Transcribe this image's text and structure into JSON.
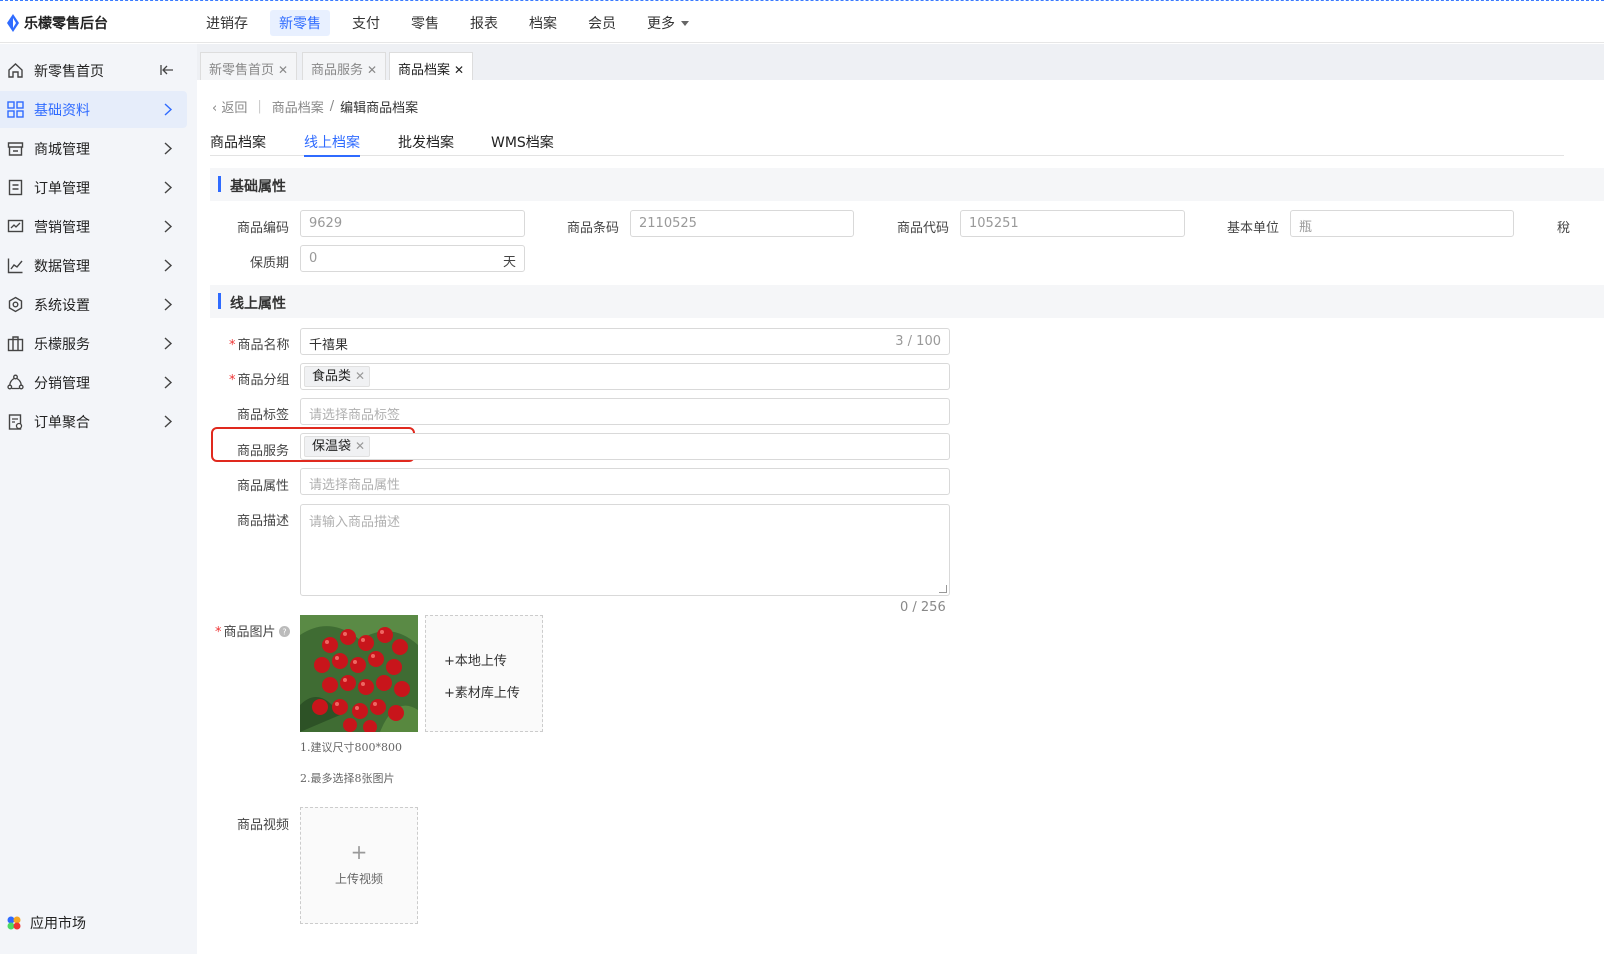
{
  "app": {
    "title": "乐檬零售后台"
  },
  "topnav": [
    "进销存",
    "新零售",
    "支付",
    "零售",
    "报表",
    "档案",
    "会员",
    "更多"
  ],
  "sidebar": {
    "items": [
      "新零售首页",
      "基础资料",
      "商城管理",
      "订单管理",
      "营销管理",
      "数据管理",
      "系统设置",
      "乐檬服务",
      "分销管理",
      "订单聚合"
    ],
    "footer": "应用市场"
  },
  "tabs": [
    {
      "label": "新零售首页"
    },
    {
      "label": "商品服务"
    },
    {
      "label": "商品档案"
    }
  ],
  "breadcrumb": {
    "back": "返回",
    "parent": "商品档案",
    "separator": "/",
    "current": "编辑商品档案"
  },
  "subtabs": [
    "商品档案",
    "线上档案",
    "批发档案",
    "WMS档案"
  ],
  "basic": {
    "title": "基础属性",
    "code_label": "商品编码",
    "code_value": "9629",
    "barcode_label": "商品条码",
    "barcode_value": "2110525",
    "itemcode_label": "商品代码",
    "itemcode_value": "105251",
    "unit_label": "基本单位",
    "unit_value": "瓶",
    "cut_label": "稅",
    "shelf_label": "保质期",
    "shelf_value": "0",
    "shelf_unit": "天"
  },
  "online": {
    "title": "线上属性",
    "name_label": "商品名称",
    "name_value": "千禧果",
    "name_count": "3 / 100",
    "group_label": "商品分组",
    "group_tag": "食品类",
    "tag_label": "商品标签",
    "tag_placeholder": "请选择商品标签",
    "service_label": "商品服务",
    "service_tag": "保温袋",
    "attr_label": "商品属性",
    "attr_placeholder": "请选择商品属性",
    "desc_label": "商品描述",
    "desc_placeholder": "请输入商品描述",
    "desc_count": "0 / 256",
    "image_label": "商品图片",
    "upload_local": "+本地上传",
    "upload_library": "+素材库上传",
    "hint1": "1.建议尺寸800*800",
    "hint2": "2.最多选择8张图片",
    "video_label": "商品视频",
    "video_plus": "+",
    "video_upload": "上传视频"
  },
  "colors": {
    "accent": "#2f6bff",
    "highlight": "#e0291e",
    "required": "#e33333"
  }
}
